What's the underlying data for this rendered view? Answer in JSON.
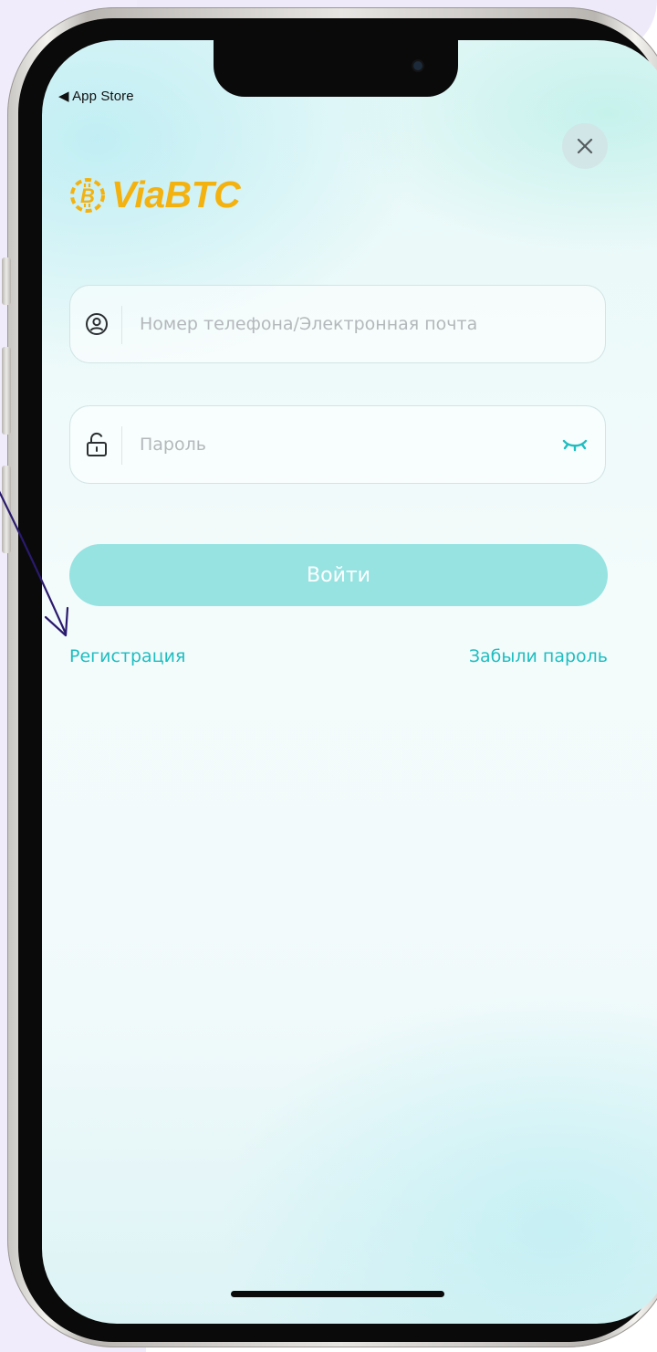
{
  "status_bar": {
    "back_label": "◀ App Store"
  },
  "app": {
    "brand": "ViaBTC",
    "brand_color": "#f3b210",
    "accent_color": "#1fbec1",
    "button_color": "#96e3e2"
  },
  "icons": {
    "close": "close-icon",
    "user": "user-icon",
    "lock": "lock-icon",
    "eye_closed": "eye-closed-icon",
    "logo": "bitcoin-logo-icon"
  },
  "form": {
    "login_placeholder": "Номер телефона/Электронная почта",
    "login_value": "",
    "password_placeholder": "Пароль",
    "password_value": "",
    "submit_label": "Войти"
  },
  "links": {
    "register": "Регистрация",
    "forgot_password": "Забыли пароль"
  }
}
